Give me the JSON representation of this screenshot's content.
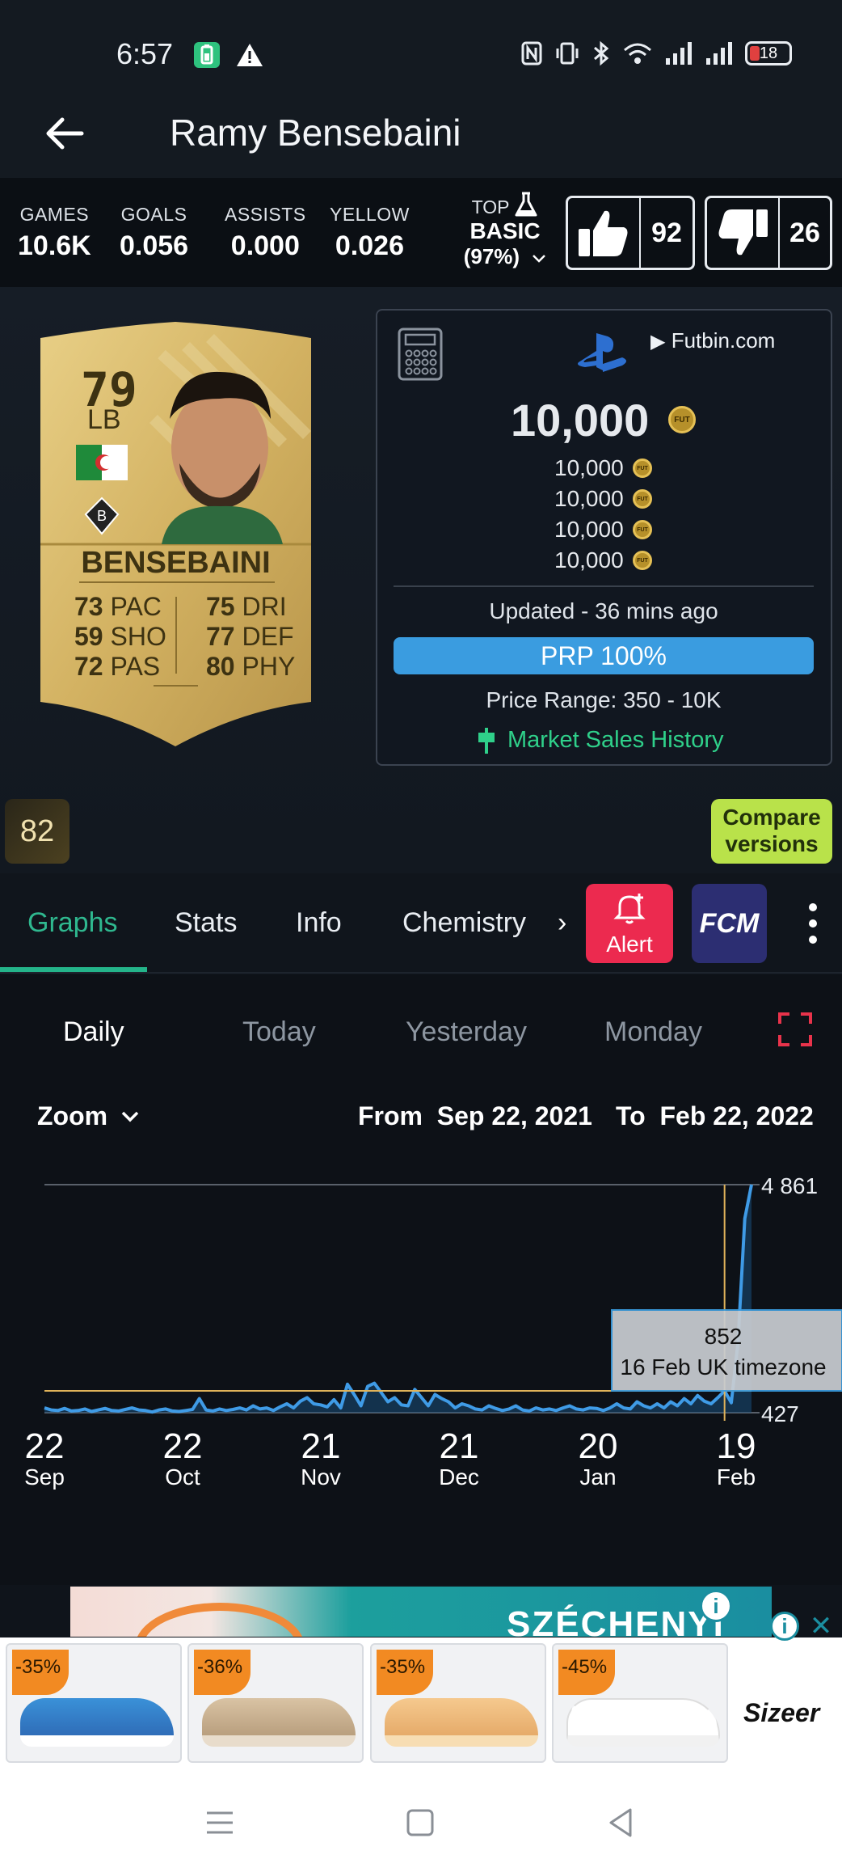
{
  "status_bar": {
    "time": "6:57",
    "battery_level": "18"
  },
  "header": {
    "title": "Ramy Bensebaini"
  },
  "stats": {
    "games": {
      "label": "GAMES",
      "value": "10.6K"
    },
    "goals": {
      "label": "GOALS",
      "value": "0.056"
    },
    "assists": {
      "label": "ASSISTS",
      "value": "0.000"
    },
    "yellow": {
      "label": "YELLOW",
      "value": "0.026"
    },
    "top": {
      "label": "TOP",
      "value": "BASIC",
      "percent": "(97%)"
    },
    "likes": "92",
    "dislikes": "26"
  },
  "card": {
    "rating": "79",
    "position": "LB",
    "name": "BENSEBAINI",
    "attrs": [
      {
        "value": "73",
        "label": "PAC"
      },
      {
        "value": "59",
        "label": "SHO"
      },
      {
        "value": "72",
        "label": "PAS"
      },
      {
        "value": "75",
        "label": "DRI"
      },
      {
        "value": "77",
        "label": "DEF"
      },
      {
        "value": "80",
        "label": "PHY"
      }
    ]
  },
  "price": {
    "source": "Futbin.com",
    "main": "10,000",
    "prices": [
      "10,000",
      "10,000",
      "10,000",
      "10,000"
    ],
    "coin_label": "FUT",
    "updated": "Updated - 36 mins ago",
    "prp": "PRP 100%",
    "range": "Price Range: 350 - 10K",
    "market_history": "Market Sales History"
  },
  "badge_rating": "82",
  "compare": {
    "line1": "Compare",
    "line2": "versions"
  },
  "tabs": [
    "Graphs",
    "Stats",
    "Info",
    "Chemistry"
  ],
  "tab_more": "›",
  "alert_label": "Alert",
  "fcm_label": "FCM",
  "range_tabs": [
    "Daily",
    "Today",
    "Yesterday",
    "Monday"
  ],
  "zoom_label": "Zoom",
  "from": {
    "label": "From",
    "date": "Sep 22, 2021"
  },
  "to": {
    "label": "To",
    "date": "Feb 22, 2022"
  },
  "chart_data": {
    "type": "line",
    "x_ticks": [
      {
        "day": "22",
        "month": "Sep"
      },
      {
        "day": "22",
        "month": "Oct"
      },
      {
        "day": "21",
        "month": "Nov"
      },
      {
        "day": "21",
        "month": "Dec"
      },
      {
        "day": "20",
        "month": "Jan"
      },
      {
        "day": "19",
        "month": "Feb"
      }
    ],
    "y_max_label": "4 861",
    "y_min_label": "427",
    "ylim": [
      427,
      4861
    ],
    "series": [
      {
        "values": [
          520,
          480,
          470,
          510,
          460,
          470,
          500,
          450,
          480,
          510,
          470,
          460,
          490,
          520,
          480,
          470,
          440,
          480,
          500,
          460,
          450,
          470,
          490,
          700,
          480,
          460,
          500,
          470,
          490,
          520,
          480,
          560,
          500,
          520,
          470,
          540,
          600,
          520,
          650,
          720,
          600,
          580,
          540,
          680,
          520,
          980,
          780,
          560,
          940,
          1000,
          820,
          640,
          720,
          580,
          560,
          880,
          720,
          560,
          780,
          700,
          640,
          520,
          600,
          560,
          500,
          480,
          560,
          510,
          470,
          500,
          560,
          480,
          460,
          520,
          480,
          500,
          470,
          520,
          560,
          500,
          480,
          520,
          510,
          470,
          520,
          600,
          520,
          500,
          640,
          560,
          520,
          600,
          520,
          640,
          560,
          700,
          600,
          760,
          650,
          600,
          720,
          852,
          620,
          1800,
          4200,
          4861
        ]
      }
    ],
    "tooltip": {
      "value": "852",
      "label": "16 Feb UK timezone"
    },
    "colors": {
      "line": "#3f9be6",
      "fill": "#1a4f7a",
      "crosshair": "#e0b35a"
    }
  },
  "ads": {
    "banner_text": "SZÉCHENYI",
    "discounts": [
      "-35%",
      "-36%",
      "-35%",
      "-45%"
    ],
    "brand": "Sizeer"
  }
}
